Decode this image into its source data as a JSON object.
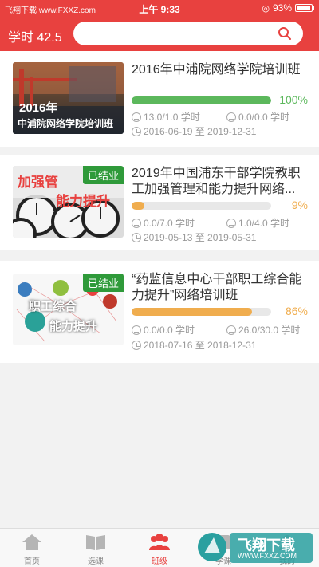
{
  "status_bar": {
    "left_text": "飞翔下载 www.FXXZ.com",
    "time": "上午 9:33",
    "battery": "93%"
  },
  "header": {
    "study_hours": "学时 42.5"
  },
  "courses": [
    {
      "title": "2016年中浦院网络学院培训班",
      "thumb_text_1": "2016年",
      "thumb_text_2": "中浦院网络学院培训班",
      "badge": "",
      "progress": 1.0,
      "percent": "100%",
      "color": "#5cb85c",
      "required_hours": "13.0/1.0 学时",
      "elective_hours": "0.0/0.0 学时",
      "date_range": "2016-06-19 至 2019-12-31"
    },
    {
      "title": "2019年中国浦东干部学院教职工加强管理和能力提升网络...",
      "thumb_text_1": "加强管",
      "thumb_text_2": "能力提升",
      "badge": "已结业",
      "progress": 0.09,
      "percent": "9%",
      "color": "#f0ad4e",
      "required_hours": "0.0/7.0 学时",
      "elective_hours": "1.0/4.0 学时",
      "date_range": "2019-05-13 至 2019-05-31"
    },
    {
      "title": "“药监信息中心干部职工综合能力提升”网络培训班",
      "thumb_text_1": "职工综合",
      "thumb_text_2": "能力提升",
      "badge": "已结业",
      "progress": 0.86,
      "percent": "86%",
      "color": "#f0ad4e",
      "required_hours": "0.0/0.0 学时",
      "elective_hours": "26.0/30.0 学时",
      "date_range": "2018-07-16 至 2018-12-31"
    }
  ],
  "tabbar": {
    "tabs": [
      {
        "label": "首页",
        "icon": "home-icon"
      },
      {
        "label": "选课",
        "icon": "book-icon"
      },
      {
        "label": "班级",
        "icon": "group-icon",
        "active": true
      },
      {
        "label": "学课",
        "icon": "study-icon"
      },
      {
        "label": "我的",
        "icon": "user-icon"
      }
    ]
  },
  "watermark": {
    "text": "飞翔下载",
    "url": "WWW.FXXZ.COM"
  },
  "colors": {
    "brand_red": "#e8413f",
    "progress_green": "#5cb85c",
    "progress_orange": "#f0ad4e",
    "badge_green": "#2f9a3a"
  }
}
